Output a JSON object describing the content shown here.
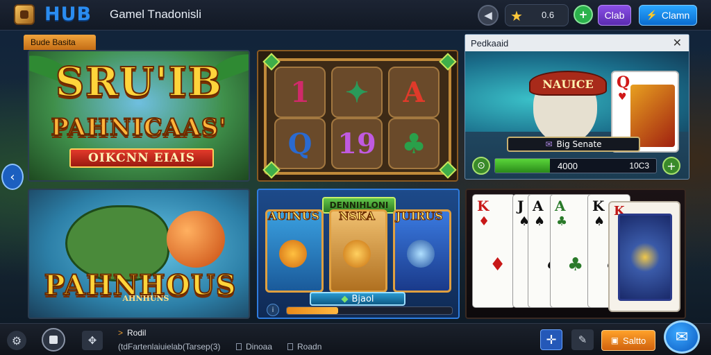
{
  "header": {
    "brand": "HUB",
    "title": "Gamel Tnadonisli",
    "coin_value": "0.6",
    "purple_button": "Clab",
    "blue_button": "Clamn",
    "icons": {
      "back": "back-icon",
      "star": "star-icon",
      "plus": "plus-icon",
      "blue_button": "plug-icon"
    }
  },
  "section_tag": "Bude Basita",
  "tiles": {
    "slot1": {
      "title_line1": "SRU'IB",
      "title_line2": "PAHNICAAS'",
      "banner": "OIKCNN EIAIS"
    },
    "slot2": {
      "cells": [
        "1",
        "✦",
        "A",
        "Q",
        "19",
        "♣"
      ]
    },
    "slot3": {
      "title": "PAHNHOUS",
      "subtitle": "AHNHUNS"
    },
    "slot4": {
      "title": "DENNIHLONI",
      "labels": [
        "AUINUS",
        "NSKA",
        "JUIRUS"
      ],
      "jackpot": "Bjaol",
      "progress_fraction": 0.31
    }
  },
  "panel": {
    "header": "Pedkaaid",
    "hat_text": "NAUICE",
    "name_plate": "Big Senate",
    "bet_value": "4000",
    "bet_max": "10C3",
    "bet_fill_fraction": 0.34
  },
  "cards": [
    {
      "rank": "K",
      "suit": "♦",
      "color": "red"
    },
    {
      "rank": "J",
      "suit": "♠",
      "color": "blk"
    },
    {
      "rank": "A",
      "suit": "♠",
      "color": "blk"
    },
    {
      "rank": "A",
      "suit": "♣",
      "color": "grn"
    },
    {
      "rank": "K",
      "suit": "♠",
      "color": "blk"
    },
    {
      "rank": "K",
      "suit": "♥",
      "color": "red"
    }
  ],
  "card_back_rank": "K",
  "bottom": {
    "title": "Rodil",
    "subtitle": "(tdFartenlaiuielab(Tarsep(3)",
    "tag1": "Dinoaa",
    "tag2": "Roadn",
    "orange_button": "Saltto",
    "icons": {
      "settings": "settings-icon",
      "stop": "stop-icon",
      "spin": "spin-icon",
      "expand": "expand-icon",
      "edit": "pencil-icon",
      "share": "share-icon"
    }
  },
  "colors": {
    "accent_blue": "#1c8cf0",
    "accent_orange": "#f0a43c",
    "accent_green": "#2bb24c",
    "accent_purple": "#8a4fe6"
  }
}
